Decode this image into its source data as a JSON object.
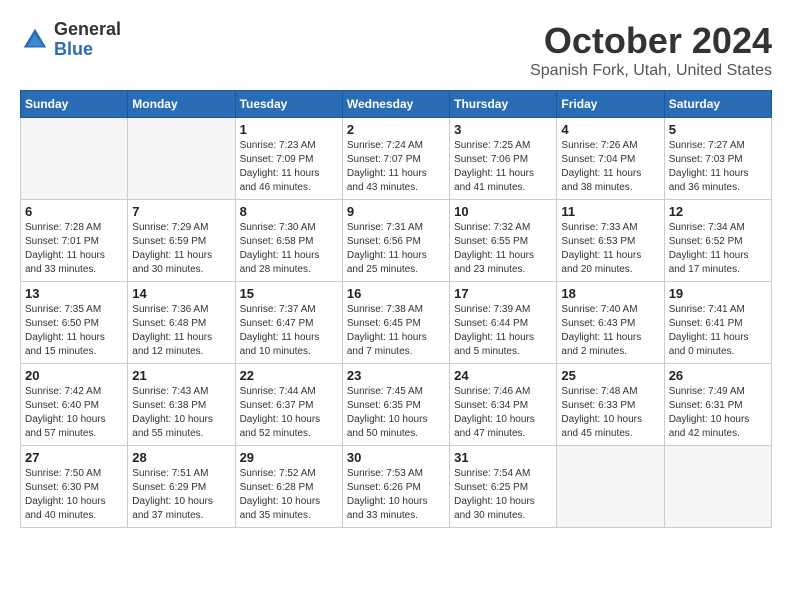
{
  "header": {
    "logo_general": "General",
    "logo_blue": "Blue",
    "month_title": "October 2024",
    "location": "Spanish Fork, Utah, United States"
  },
  "weekdays": [
    "Sunday",
    "Monday",
    "Tuesday",
    "Wednesday",
    "Thursday",
    "Friday",
    "Saturday"
  ],
  "weeks": [
    [
      {
        "day": "",
        "info": ""
      },
      {
        "day": "",
        "info": ""
      },
      {
        "day": "1",
        "info": "Sunrise: 7:23 AM\nSunset: 7:09 PM\nDaylight: 11 hours and 46 minutes."
      },
      {
        "day": "2",
        "info": "Sunrise: 7:24 AM\nSunset: 7:07 PM\nDaylight: 11 hours and 43 minutes."
      },
      {
        "day": "3",
        "info": "Sunrise: 7:25 AM\nSunset: 7:06 PM\nDaylight: 11 hours and 41 minutes."
      },
      {
        "day": "4",
        "info": "Sunrise: 7:26 AM\nSunset: 7:04 PM\nDaylight: 11 hours and 38 minutes."
      },
      {
        "day": "5",
        "info": "Sunrise: 7:27 AM\nSunset: 7:03 PM\nDaylight: 11 hours and 36 minutes."
      }
    ],
    [
      {
        "day": "6",
        "info": "Sunrise: 7:28 AM\nSunset: 7:01 PM\nDaylight: 11 hours and 33 minutes."
      },
      {
        "day": "7",
        "info": "Sunrise: 7:29 AM\nSunset: 6:59 PM\nDaylight: 11 hours and 30 minutes."
      },
      {
        "day": "8",
        "info": "Sunrise: 7:30 AM\nSunset: 6:58 PM\nDaylight: 11 hours and 28 minutes."
      },
      {
        "day": "9",
        "info": "Sunrise: 7:31 AM\nSunset: 6:56 PM\nDaylight: 11 hours and 25 minutes."
      },
      {
        "day": "10",
        "info": "Sunrise: 7:32 AM\nSunset: 6:55 PM\nDaylight: 11 hours and 23 minutes."
      },
      {
        "day": "11",
        "info": "Sunrise: 7:33 AM\nSunset: 6:53 PM\nDaylight: 11 hours and 20 minutes."
      },
      {
        "day": "12",
        "info": "Sunrise: 7:34 AM\nSunset: 6:52 PM\nDaylight: 11 hours and 17 minutes."
      }
    ],
    [
      {
        "day": "13",
        "info": "Sunrise: 7:35 AM\nSunset: 6:50 PM\nDaylight: 11 hours and 15 minutes."
      },
      {
        "day": "14",
        "info": "Sunrise: 7:36 AM\nSunset: 6:48 PM\nDaylight: 11 hours and 12 minutes."
      },
      {
        "day": "15",
        "info": "Sunrise: 7:37 AM\nSunset: 6:47 PM\nDaylight: 11 hours and 10 minutes."
      },
      {
        "day": "16",
        "info": "Sunrise: 7:38 AM\nSunset: 6:45 PM\nDaylight: 11 hours and 7 minutes."
      },
      {
        "day": "17",
        "info": "Sunrise: 7:39 AM\nSunset: 6:44 PM\nDaylight: 11 hours and 5 minutes."
      },
      {
        "day": "18",
        "info": "Sunrise: 7:40 AM\nSunset: 6:43 PM\nDaylight: 11 hours and 2 minutes."
      },
      {
        "day": "19",
        "info": "Sunrise: 7:41 AM\nSunset: 6:41 PM\nDaylight: 11 hours and 0 minutes."
      }
    ],
    [
      {
        "day": "20",
        "info": "Sunrise: 7:42 AM\nSunset: 6:40 PM\nDaylight: 10 hours and 57 minutes."
      },
      {
        "day": "21",
        "info": "Sunrise: 7:43 AM\nSunset: 6:38 PM\nDaylight: 10 hours and 55 minutes."
      },
      {
        "day": "22",
        "info": "Sunrise: 7:44 AM\nSunset: 6:37 PM\nDaylight: 10 hours and 52 minutes."
      },
      {
        "day": "23",
        "info": "Sunrise: 7:45 AM\nSunset: 6:35 PM\nDaylight: 10 hours and 50 minutes."
      },
      {
        "day": "24",
        "info": "Sunrise: 7:46 AM\nSunset: 6:34 PM\nDaylight: 10 hours and 47 minutes."
      },
      {
        "day": "25",
        "info": "Sunrise: 7:48 AM\nSunset: 6:33 PM\nDaylight: 10 hours and 45 minutes."
      },
      {
        "day": "26",
        "info": "Sunrise: 7:49 AM\nSunset: 6:31 PM\nDaylight: 10 hours and 42 minutes."
      }
    ],
    [
      {
        "day": "27",
        "info": "Sunrise: 7:50 AM\nSunset: 6:30 PM\nDaylight: 10 hours and 40 minutes."
      },
      {
        "day": "28",
        "info": "Sunrise: 7:51 AM\nSunset: 6:29 PM\nDaylight: 10 hours and 37 minutes."
      },
      {
        "day": "29",
        "info": "Sunrise: 7:52 AM\nSunset: 6:28 PM\nDaylight: 10 hours and 35 minutes."
      },
      {
        "day": "30",
        "info": "Sunrise: 7:53 AM\nSunset: 6:26 PM\nDaylight: 10 hours and 33 minutes."
      },
      {
        "day": "31",
        "info": "Sunrise: 7:54 AM\nSunset: 6:25 PM\nDaylight: 10 hours and 30 minutes."
      },
      {
        "day": "",
        "info": ""
      },
      {
        "day": "",
        "info": ""
      }
    ]
  ]
}
